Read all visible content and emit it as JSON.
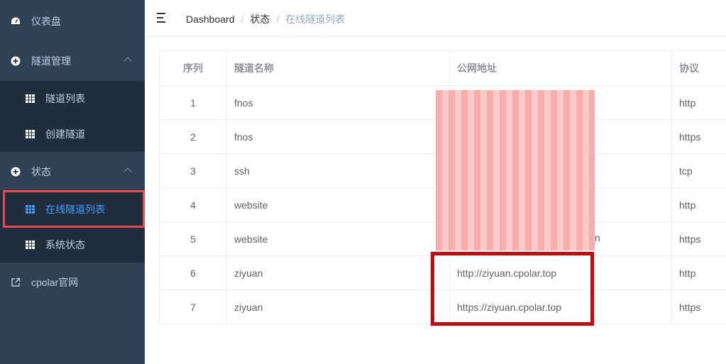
{
  "sidebar": {
    "dashboard": {
      "label": "仪表盘",
      "icon": "dashboard-icon"
    },
    "tunnel_mgmt": {
      "label": "隧道管理",
      "icon": "plus-circle-icon"
    },
    "tunnel_list": {
      "label": "隧道列表",
      "icon": "table-icon"
    },
    "create_tunnel": {
      "label": "创建隧道",
      "icon": "table-icon"
    },
    "status": {
      "label": "状态",
      "icon": "plus-circle-icon"
    },
    "online_tunnels": {
      "label": "在线隧道列表",
      "icon": "table-icon"
    },
    "system_status": {
      "label": "系统状态",
      "icon": "table-icon"
    },
    "website": {
      "label": "cpolar官网",
      "icon": "external-link-icon"
    }
  },
  "header": {
    "breadcrumb": [
      "Dashboard",
      "状态",
      "在线隧道列表"
    ],
    "separator": "/"
  },
  "table": {
    "columns": [
      "序列",
      "隧道名称",
      "公网地址",
      "协议"
    ],
    "rows": [
      {
        "index": "1",
        "name": "fnos",
        "url": "",
        "protocol": "http"
      },
      {
        "index": "2",
        "name": "fnos",
        "url": "",
        "protocol": "https"
      },
      {
        "index": "3",
        "name": "ssh",
        "url": "",
        "protocol": "tcp"
      },
      {
        "index": "4",
        "name": "website",
        "url": "",
        "protocol": "http"
      },
      {
        "index": "5",
        "name": "website",
        "url": "n",
        "protocol": "https"
      },
      {
        "index": "6",
        "name": "ziyuan",
        "url": "http://ziyuan.cpolar.top",
        "protocol": "http"
      },
      {
        "index": "7",
        "name": "ziyuan",
        "url": "https://ziyuan.cpolar.top",
        "protocol": "https"
      }
    ]
  },
  "colors": {
    "sidebar_bg": "#304156",
    "submenu_bg": "#1f2d3d",
    "active_text": "#409eff",
    "highlight_red": "#b80f12"
  }
}
